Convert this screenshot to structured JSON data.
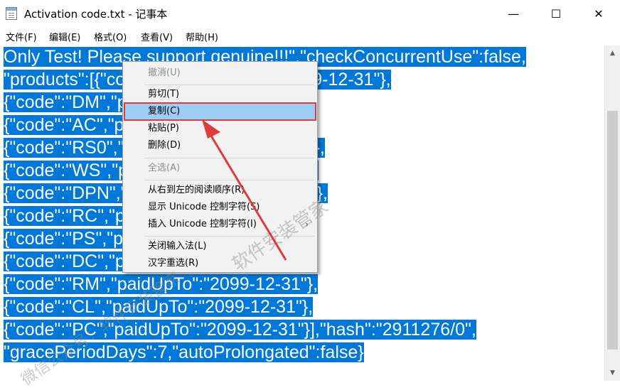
{
  "window": {
    "title": "Activation code.txt - 记事本",
    "minimize_glyph": "—",
    "maximize_glyph": "☐",
    "close_glyph": "✕"
  },
  "menubar": {
    "items": [
      "文件(F)",
      "编辑(E)",
      "格式(O)",
      "查看(V)",
      "帮助(H)"
    ]
  },
  "editor": {
    "lines": [
      "Only Test! Please support genuine!!!\",\"checkConcurrentUse\":false,",
      "\"products\":[{\"code\":\"II\",\"paidUpTo\":\"2099-12-31\"},",
      "{\"code\":\"DM\",\"paidUpTo\":\"2099-12-31\"},",
      "{\"code\":\"AC\",\"paidUpTo\":\"2099-12-31\"},",
      "{\"code\":\"RS0\",\"paidUpTo\":\"2099-12-31\"},",
      "{\"code\":\"WS\",\"paidUpTo\":\"2099-12-31\"},",
      "{\"code\":\"DPN\",\"paidUpTo\":\"2099-12-31\"},",
      "{\"code\":\"RC\",\"paidUpTo\":\"2099-12-31\"},",
      "{\"code\":\"PS\",\"paidUpTo\":\"2099-12-31\"},",
      "{\"code\":\"DC\",\"paidUpTo\":\"2099-12-31\"},",
      "{\"code\":\"RM\",\"paidUpTo\":\"2099-12-31\"},",
      "{\"code\":\"CL\",\"paidUpTo\":\"2099-12-31\"},",
      "{\"code\":\"PC\",\"paidUpTo\":\"2099-12-31\"}],\"hash\":\"2911276/0\",",
      "\"gracePeriodDays\":7,\"autoProlongated\":false}"
    ],
    "selection_color": "#0078d7"
  },
  "context_menu": {
    "items": [
      {
        "label": "撤消(U)",
        "disabled": true
      },
      {
        "separator": true
      },
      {
        "label": "剪切(T)"
      },
      {
        "label": "复制(C)",
        "highlighted": true
      },
      {
        "label": "粘贴(P)"
      },
      {
        "label": "删除(D)"
      },
      {
        "separator": true
      },
      {
        "label": "全选(A)",
        "disabled": true
      },
      {
        "separator": true
      },
      {
        "label": "从右到左的阅读顺序(R)"
      },
      {
        "label": "显示 Unicode 控制字符(S)"
      },
      {
        "label": "插入 Unicode 控制字符(I)",
        "submenu": true
      },
      {
        "separator": true
      },
      {
        "label": "关闭输入法(L)"
      },
      {
        "label": "汉字重选(R)"
      }
    ],
    "highlight_color": "#9ccdf5",
    "annotation_color": "#e0393e"
  },
  "watermark": {
    "text_1": "软件安装管家",
    "text_2": "微信公众号：软件安装管家"
  },
  "icons": {
    "app": "notepad-icon",
    "submenu": "chevron-right-icon",
    "scroll_up": "scroll-up-arrow-icon",
    "scroll_down": "scroll-down-arrow-icon",
    "annotation": "red-arrow-icon"
  }
}
